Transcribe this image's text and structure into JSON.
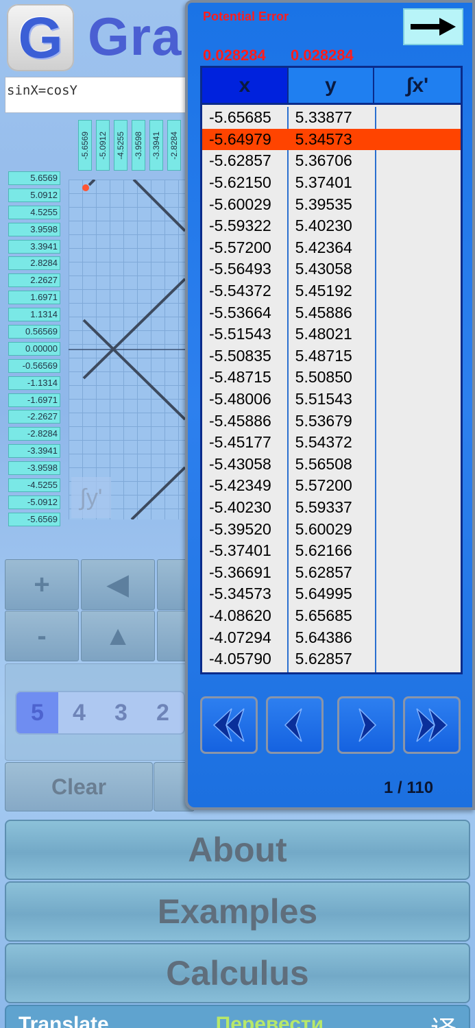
{
  "app": {
    "logo_letter": "G",
    "title": "Gra",
    "equation": "sinX=cosY"
  },
  "graph": {
    "x_ticks": [
      "-5.6569",
      "-5.0912",
      "-4.5255",
      "-3.9598",
      "-3.3941",
      "-2.8284"
    ],
    "y_ticks": [
      "5.6569",
      "5.0912",
      "4.5255",
      "3.9598",
      "3.3941",
      "2.8284",
      "2.2627",
      "1.6971",
      "1.1314",
      "0.56569",
      "0.00000",
      "-0.56569",
      "-1.1314",
      "-1.6971",
      "-2.2627",
      "-2.8284",
      "-3.3941",
      "-3.9598",
      "-4.5255",
      "-5.0912",
      "-5.6569"
    ],
    "y_prime_label": "∫y'"
  },
  "pad": {
    "plus": "+",
    "minus": "-",
    "left_arrow": "◀",
    "up_arrow": "▲",
    "digits": [
      "5",
      "4",
      "3",
      "2"
    ],
    "clear_label": "Clear"
  },
  "menu": {
    "about": "About",
    "examples": "Examples",
    "calculus": "Calculus"
  },
  "translate": {
    "en": "Translate",
    "ru": "Перевести",
    "zh": "译"
  },
  "panel": {
    "potential_error_label": "Potential Error",
    "error_values": [
      "0.028284",
      "0.028284"
    ],
    "columns": [
      "x",
      "y",
      "∫x'"
    ],
    "selected_row": 1,
    "rows": [
      [
        "-5.65685",
        "5.33877",
        ""
      ],
      [
        "-5.64979",
        "5.34573",
        ""
      ],
      [
        "-5.62857",
        "5.36706",
        ""
      ],
      [
        "-5.62150",
        "5.37401",
        ""
      ],
      [
        "-5.60029",
        "5.39535",
        ""
      ],
      [
        "-5.59322",
        "5.40230",
        ""
      ],
      [
        "-5.57200",
        "5.42364",
        ""
      ],
      [
        "-5.56493",
        "5.43058",
        ""
      ],
      [
        "-5.54372",
        "5.45192",
        ""
      ],
      [
        "-5.53664",
        "5.45886",
        ""
      ],
      [
        "-5.51543",
        "5.48021",
        ""
      ],
      [
        "-5.50835",
        "5.48715",
        ""
      ],
      [
        "-5.48715",
        "5.50850",
        ""
      ],
      [
        "-5.48006",
        "5.51543",
        ""
      ],
      [
        "-5.45886",
        "5.53679",
        ""
      ],
      [
        "-5.45177",
        "5.54372",
        ""
      ],
      [
        "-5.43058",
        "5.56508",
        ""
      ],
      [
        "-5.42349",
        "5.57200",
        ""
      ],
      [
        "-5.40230",
        "5.59337",
        ""
      ],
      [
        "-5.39520",
        "5.60029",
        ""
      ],
      [
        "-5.37401",
        "5.62166",
        ""
      ],
      [
        "-5.36691",
        "5.62857",
        ""
      ],
      [
        "-5.34573",
        "5.64995",
        ""
      ],
      [
        "-4.08620",
        "5.65685",
        ""
      ],
      [
        "-4.07294",
        "5.64386",
        ""
      ],
      [
        "-4.05790",
        "5.62857",
        ""
      ]
    ],
    "page_indicator": "1 / 110"
  },
  "colors": {
    "panel_blue": "#1a73e6",
    "header_dark": "#0022dd",
    "selected_row": "#ff4400",
    "error_red": "#ff1d1d",
    "tick_cyan": "#7ae8e6"
  }
}
